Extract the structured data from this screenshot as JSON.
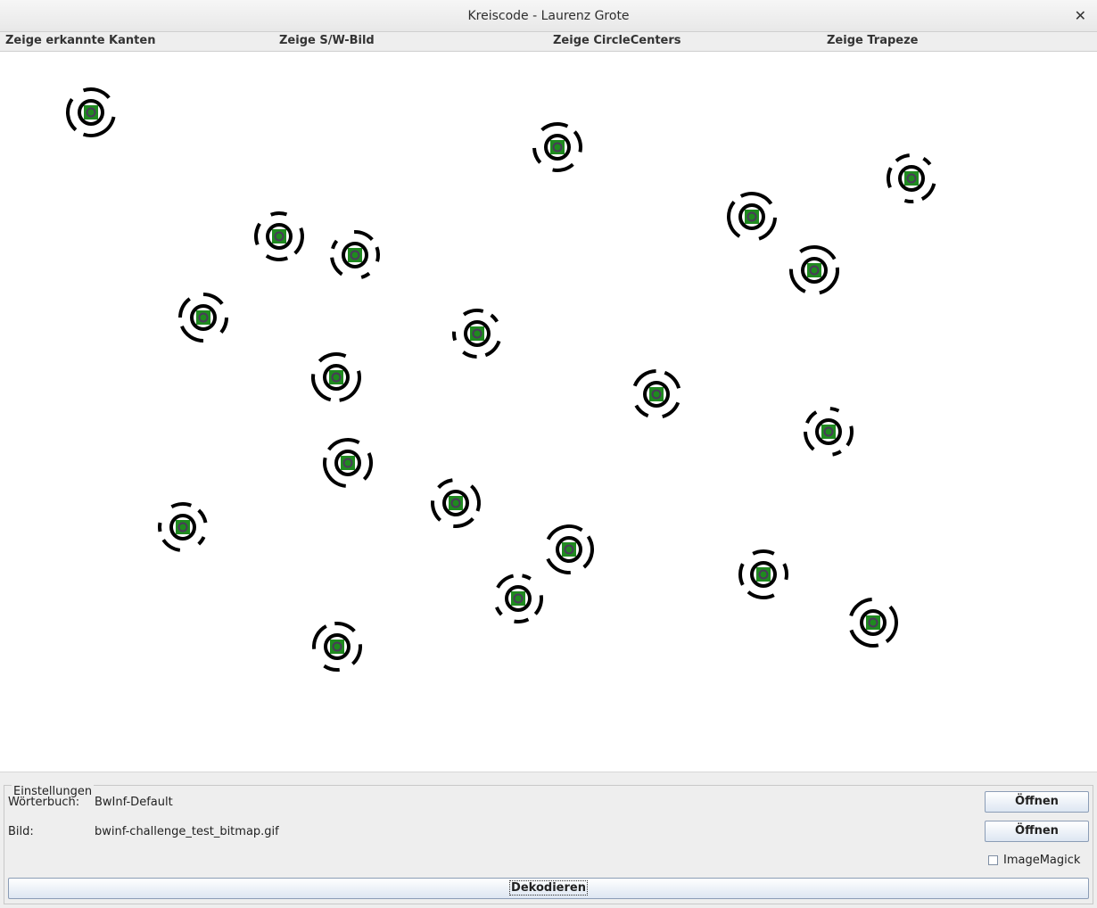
{
  "window": {
    "title": "Kreiscode - Laurenz Grote",
    "close_glyph": "✕"
  },
  "menu": [
    {
      "label": "Zeige erkannte Kanten"
    },
    {
      "label": "Zeige S/W-Bild"
    },
    {
      "label": "Zeige CircleCenters"
    },
    {
      "label": "Zeige Trapeze"
    }
  ],
  "icons": {
    "close": "close-icon",
    "marker": "circle-code-marker",
    "checkbox": "checkbox-icon"
  },
  "colors": {
    "marker_ring": "#000000",
    "marker_center": "#1f8a1f",
    "marker_center_dark": "#4a3a5a",
    "button_border": "#8b9db6"
  },
  "settings": {
    "legend": "Einstellungen",
    "dictionary_label": "Wörterbuch:",
    "dictionary_value": "BwInf-Default",
    "image_label": "Bild:",
    "image_value": "bwinf-challenge_test_bitmap.gif",
    "open_dictionary_label": "Öffnen",
    "open_image_label": "Öffnen",
    "imagemagick_label": "ImageMagick",
    "imagemagick_checked": false,
    "decode_label": "Dekodieren"
  }
}
